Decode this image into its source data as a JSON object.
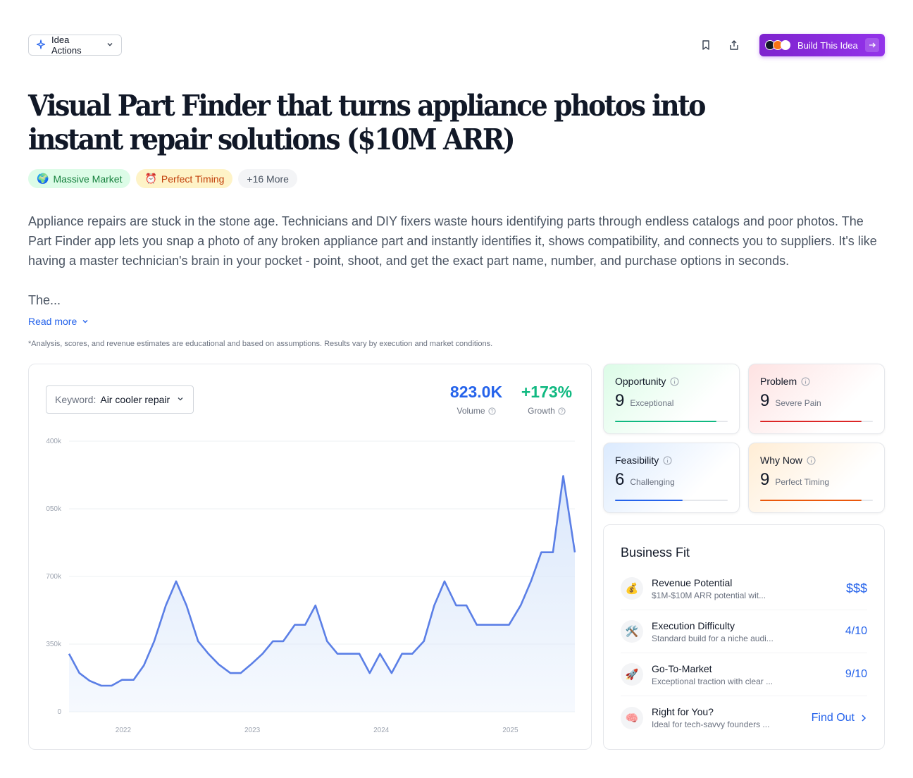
{
  "toolbar": {
    "idea_actions_label": "Idea Actions",
    "build_label": "Build This Idea"
  },
  "idea": {
    "title": "Visual Part Finder that turns appliance photos into instant repair solutions ($10M ARR)",
    "tags": [
      {
        "emoji": "🌍",
        "label": "Massive Market"
      },
      {
        "emoji": "⏰",
        "label": "Perfect Timing"
      },
      {
        "label": "+16 More"
      }
    ],
    "description_p1": "Appliance repairs are stuck in the stone age. Technicians and DIY fixers waste hours identifying parts through endless catalogs and poor photos. The Part Finder app lets you snap a photo of any broken appliance part and instantly identifies it, shows compatibility, and connects you to suppliers. It's like having a master technician's brain in your pocket - point, shoot, and get the exact part name, number, and purchase options in seconds.",
    "description_p2": "The...",
    "read_more": "Read more",
    "disclaimer": "*Analysis, scores, and revenue estimates are educational and based on assumptions. Results vary by execution and market conditions."
  },
  "trend": {
    "keyword_label": "Keyword:",
    "keyword_value": "Air cooler repair",
    "volume_value": "823.0K",
    "volume_label": "Volume",
    "growth_value": "+173%",
    "growth_label": "Growth"
  },
  "chart_data": {
    "type": "area",
    "y_tick_labels": [
      "0",
      "350k",
      "700k",
      "050k",
      "400k"
    ],
    "y_ticks": [
      0,
      350000,
      700000,
      1050000,
      1400000
    ],
    "ylim": [
      0,
      1400000
    ],
    "x_tick_labels": [
      "2022",
      "2023",
      "2024",
      "2025"
    ],
    "x_ticks": [
      2022,
      2023,
      2024,
      2025
    ],
    "xlim": [
      2021.58,
      2025.5
    ],
    "line_color": "#5b7fe6",
    "fill_color": "#dbe8fb",
    "points": [
      [
        2021.58,
        300000
      ],
      [
        2021.66,
        200000
      ],
      [
        2021.74,
        160000
      ],
      [
        2021.83,
        135000
      ],
      [
        2021.91,
        135000
      ],
      [
        2021.99,
        165000
      ],
      [
        2022.08,
        165000
      ],
      [
        2022.16,
        240000
      ],
      [
        2022.24,
        365000
      ],
      [
        2022.33,
        550000
      ],
      [
        2022.41,
        675000
      ],
      [
        2022.49,
        550000
      ],
      [
        2022.58,
        365000
      ],
      [
        2022.66,
        300000
      ],
      [
        2022.74,
        245000
      ],
      [
        2022.83,
        200000
      ],
      [
        2022.91,
        200000
      ],
      [
        2022.99,
        245000
      ],
      [
        2023.08,
        300000
      ],
      [
        2023.16,
        365000
      ],
      [
        2023.24,
        365000
      ],
      [
        2023.33,
        450000
      ],
      [
        2023.41,
        450000
      ],
      [
        2023.49,
        550000
      ],
      [
        2023.58,
        365000
      ],
      [
        2023.66,
        300000
      ],
      [
        2023.74,
        300000
      ],
      [
        2023.83,
        300000
      ],
      [
        2023.91,
        200000
      ],
      [
        2023.99,
        300000
      ],
      [
        2024.08,
        200000
      ],
      [
        2024.16,
        300000
      ],
      [
        2024.24,
        300000
      ],
      [
        2024.33,
        365000
      ],
      [
        2024.41,
        550000
      ],
      [
        2024.49,
        675000
      ],
      [
        2024.58,
        550000
      ],
      [
        2024.66,
        550000
      ],
      [
        2024.74,
        450000
      ],
      [
        2024.83,
        450000
      ],
      [
        2024.91,
        450000
      ],
      [
        2024.99,
        450000
      ],
      [
        2025.08,
        550000
      ],
      [
        2025.16,
        675000
      ],
      [
        2025.24,
        825000
      ],
      [
        2025.33,
        825000
      ],
      [
        2025.41,
        1220000
      ],
      [
        2025.5,
        825000
      ]
    ]
  },
  "scores": {
    "opportunity": {
      "label": "Opportunity",
      "value": "9",
      "desc": "Exceptional",
      "fill": 0.9,
      "color": "#10b981"
    },
    "problem": {
      "label": "Problem",
      "value": "9",
      "desc": "Severe Pain",
      "fill": 0.9,
      "color": "#dc2626"
    },
    "feasibility": {
      "label": "Feasibility",
      "value": "6",
      "desc": "Challenging",
      "fill": 0.6,
      "color": "#2563eb"
    },
    "why_now": {
      "label": "Why Now",
      "value": "9",
      "desc": "Perfect Timing",
      "fill": 0.9,
      "color": "#ea580c"
    }
  },
  "business_fit": {
    "title": "Business Fit",
    "rows": [
      {
        "emoji": "💰",
        "title": "Revenue Potential",
        "sub": "$1M-$10M ARR potential wit...",
        "value": "$$$"
      },
      {
        "emoji": "🛠️",
        "title": "Execution Difficulty",
        "sub": "Standard build for a niche audi...",
        "value": "4/10"
      },
      {
        "emoji": "🚀",
        "title": "Go-To-Market",
        "sub": "Exceptional traction with clear ...",
        "value": "9/10"
      },
      {
        "emoji": "🧠",
        "title": "Right for You?",
        "sub": "Ideal for tech-savvy founders ...",
        "value": "Find Out"
      }
    ]
  }
}
